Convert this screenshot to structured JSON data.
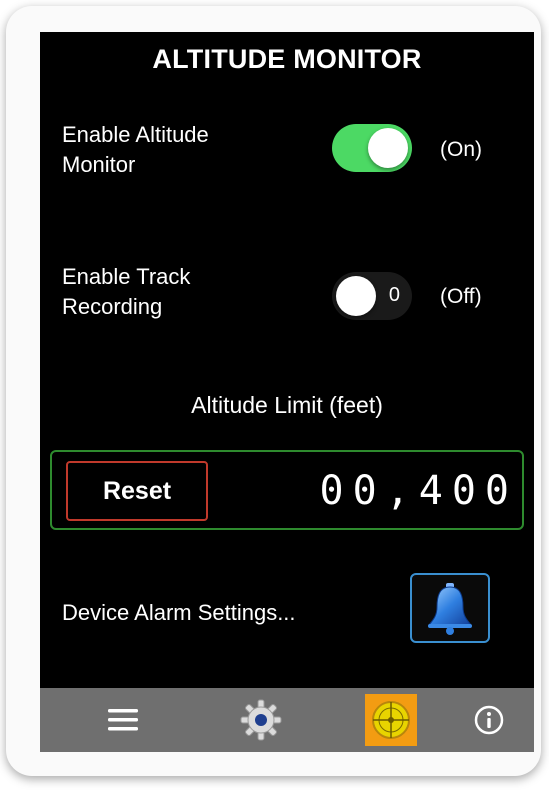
{
  "header": {
    "title": "ALTITUDE MONITOR"
  },
  "altitude_monitor": {
    "label_line1": "Enable Altitude",
    "label_line2": "Monitor",
    "enabled": true,
    "state_text": "(On)"
  },
  "track_recording": {
    "label_line1": "Enable Track",
    "label_line2": "Recording",
    "enabled": false,
    "switch_off_mark": "0",
    "state_text": "(Off)"
  },
  "altitude_limit": {
    "label": "Altitude Limit (feet)",
    "reset_label": "Reset",
    "value_display": "00,400"
  },
  "alarm": {
    "label": "Device Alarm Settings..."
  },
  "tabbar": {
    "items": [
      {
        "icon": "menu-icon"
      },
      {
        "icon": "gear-icon"
      },
      {
        "icon": "compass-icon",
        "active": true
      },
      {
        "icon": "info-icon"
      }
    ]
  },
  "colors": {
    "switch_on": "#4cd964",
    "limit_border": "#2e8b2e",
    "reset_border": "#c0392b",
    "alarm_border": "#3a8fd0",
    "tabbar_bg": "#6f6f6f",
    "compass_bg": "#f39c12"
  }
}
